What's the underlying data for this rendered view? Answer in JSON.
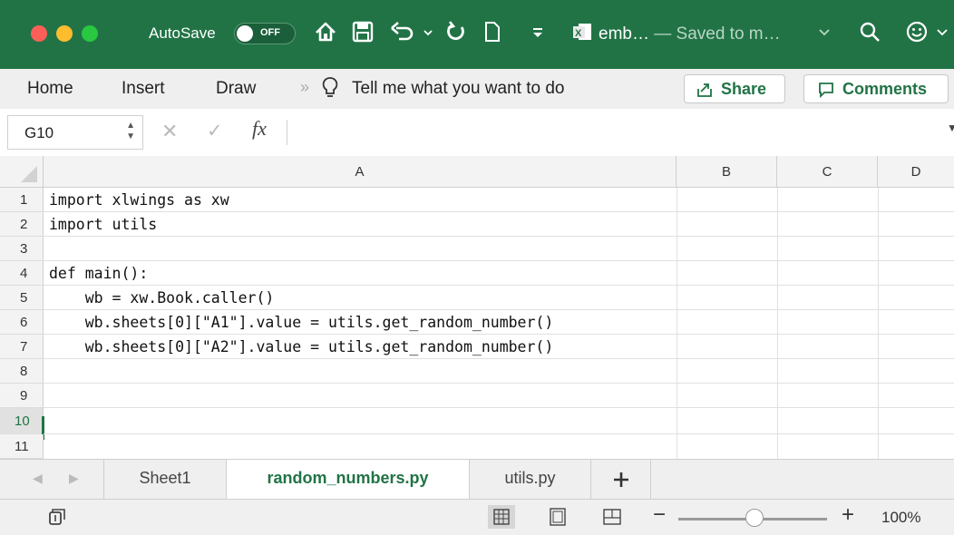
{
  "titlebar": {
    "autosave_label": "AutoSave",
    "autosave_state": "OFF",
    "doc_name": "emb…",
    "saved_status": "— Saved to m…",
    "accent_color": "#217346"
  },
  "ribbon": {
    "tabs": [
      "Home",
      "Insert",
      "Draw"
    ],
    "tell_me": "Tell me what you want to do",
    "share_label": "Share",
    "comments_label": "Comments"
  },
  "formula_bar": {
    "name_box": "G10",
    "formula": ""
  },
  "columns": [
    "A",
    "B",
    "C",
    "D"
  ],
  "rows": [
    {
      "num": "1",
      "a": "import xlwings as xw"
    },
    {
      "num": "2",
      "a": "import utils"
    },
    {
      "num": "3",
      "a": ""
    },
    {
      "num": "4",
      "a": "def main():"
    },
    {
      "num": "5",
      "a": "    wb = xw.Book.caller()"
    },
    {
      "num": "6",
      "a": "    wb.sheets[0][\"A1\"].value = utils.get_random_number()"
    },
    {
      "num": "7",
      "a": "    wb.sheets[0][\"A2\"].value = utils.get_random_number()"
    },
    {
      "num": "8",
      "a": ""
    },
    {
      "num": "9",
      "a": ""
    },
    {
      "num": "10",
      "a": ""
    },
    {
      "num": "11",
      "a": ""
    }
  ],
  "sheets": [
    "Sheet1",
    "random_numbers.py",
    "utils.py"
  ],
  "active_sheet": "random_numbers.py",
  "status": {
    "zoom": "100%"
  }
}
